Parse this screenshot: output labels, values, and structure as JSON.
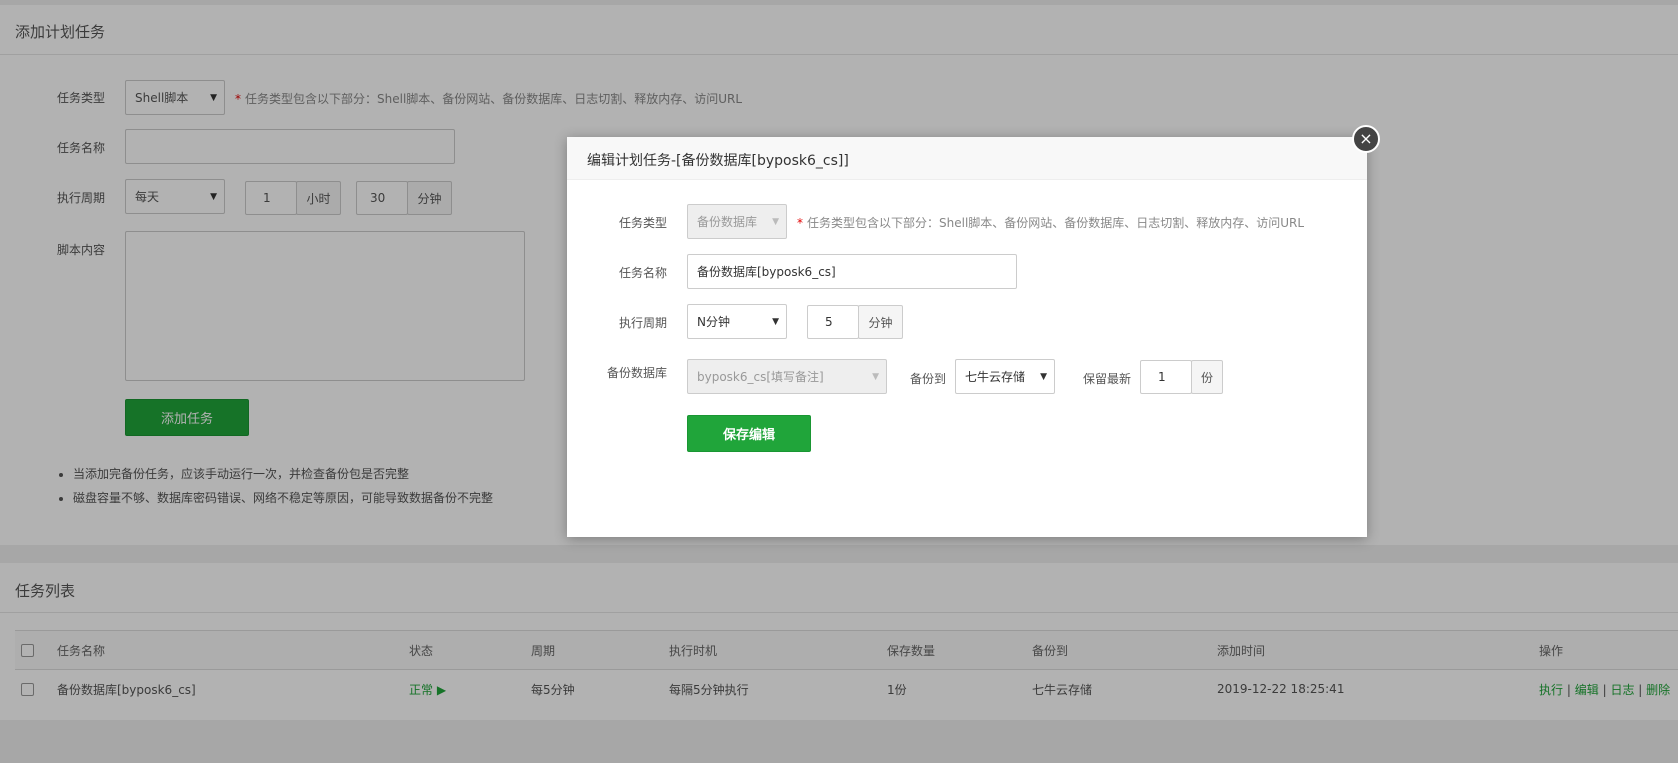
{
  "add_panel": {
    "title": "添加计划任务",
    "form": {
      "type_label": "任务类型",
      "type_value": "Shell脚本",
      "type_hint_star": "*",
      "type_hint": "任务类型包含以下部分：Shell脚本、备份网站、备份数据库、日志切割、释放内存、访问URL",
      "name_label": "任务名称",
      "name_value": "",
      "cycle_label": "执行周期",
      "cycle_value": "每天",
      "hour_value": "1",
      "hour_unit": "小时",
      "minute_value": "30",
      "minute_unit": "分钟",
      "script_label": "脚本内容",
      "script_value": "",
      "add_button": "添加任务"
    },
    "notes": [
      "当添加完备份任务，应该手动运行一次，并检查备份包是否完整",
      "磁盘容量不够、数据库密码错误、网络不稳定等原因，可能导致数据备份不完整"
    ]
  },
  "list_panel": {
    "title": "任务列表",
    "columns": [
      "任务名称",
      "状态",
      "周期",
      "执行时机",
      "保存数量",
      "备份到",
      "添加时间",
      "操作"
    ],
    "rows": [
      {
        "name": "备份数据库[byposk6_cs]",
        "status": "正常",
        "status_icon": "▶",
        "cycle": "每5分钟",
        "timing": "每隔5分钟执行",
        "keep": "1份",
        "backup_to": "七牛云存储",
        "added": "2019-12-22 18:25:41",
        "actions": {
          "run": "执行",
          "edit": "编辑",
          "log": "日志",
          "delete": "删除",
          "sep": "|"
        }
      }
    ]
  },
  "modal": {
    "title": "编辑计划任务-[备份数据库[byposk6_cs]]",
    "close_icon": "×",
    "type_label": "任务类型",
    "type_value": "备份数据库",
    "type_hint_star": "*",
    "type_hint": "任务类型包含以下部分：Shell脚本、备份网站、备份数据库、日志切割、释放内存、访问URL",
    "name_label": "任务名称",
    "name_value": "备份数据库[byposk6_cs]",
    "cycle_label": "执行周期",
    "cycle_value": "N分钟",
    "minute_value": "5",
    "minute_unit": "分钟",
    "db_label": "备份数据库",
    "db_value": "byposk6_cs[填写备注]",
    "backup_to_label": "备份到",
    "backup_to_value": "七牛云存储",
    "keep_label": "保留最新",
    "keep_value": "1",
    "keep_unit": "份",
    "save_button": "保存编辑"
  },
  "colors": {
    "accent": "#20a53a",
    "required": "#e30000"
  }
}
